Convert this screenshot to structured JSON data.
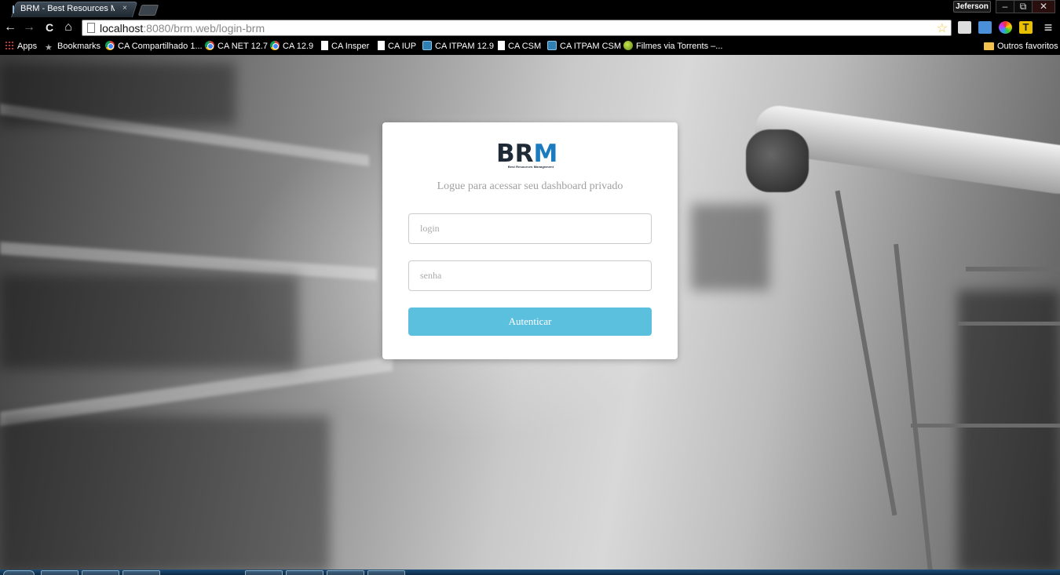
{
  "browser": {
    "tab_title": "BRM - Best Resources Ma",
    "tab_close": "×",
    "profile_name": "Jeferson",
    "window_controls": {
      "minimize": "–",
      "maximize": "⧉",
      "close": "✕"
    },
    "url_host": "localhost",
    "url_rest": ":8080/brm.web/login-brm",
    "nav": {
      "back": "←",
      "forward": "→",
      "reload": "C",
      "home": "⌂",
      "menu": "≡"
    }
  },
  "bookmarks": {
    "items": [
      {
        "label": "Apps",
        "icon": "apps-grid-icon"
      },
      {
        "label": "Bookmarks",
        "icon": "star-icon"
      },
      {
        "label": "CA Compartilhado 1...",
        "icon": "chrome-icon"
      },
      {
        "label": "CA NET 12.7",
        "icon": "chrome-icon"
      },
      {
        "label": "CA 12.9",
        "icon": "chrome-icon"
      },
      {
        "label": "CA Insper",
        "icon": "page-icon"
      },
      {
        "label": "CA IUP",
        "icon": "page-icon"
      },
      {
        "label": "CA ITPAM 12.9",
        "icon": "ca-icon"
      },
      {
        "label": "CA CSM",
        "icon": "page-icon"
      },
      {
        "label": "CA ITPAM CSM",
        "icon": "ca-icon"
      },
      {
        "label": "Filmes via Torrents –...",
        "icon": "torrent-icon"
      }
    ],
    "other": "Outros favoritos"
  },
  "login": {
    "logo_text_left": "BR",
    "logo_text_right": "M",
    "logo_tagline": "Best Resources Management",
    "subtitle": "Logue para acessar seu dashboard privado",
    "login_placeholder": "login",
    "password_placeholder": "senha",
    "submit_label": "Autenticar"
  },
  "colors": {
    "accent": "#5bc0de",
    "logo_dark": "#1e2a36",
    "logo_blue": "#1a7bbf"
  }
}
